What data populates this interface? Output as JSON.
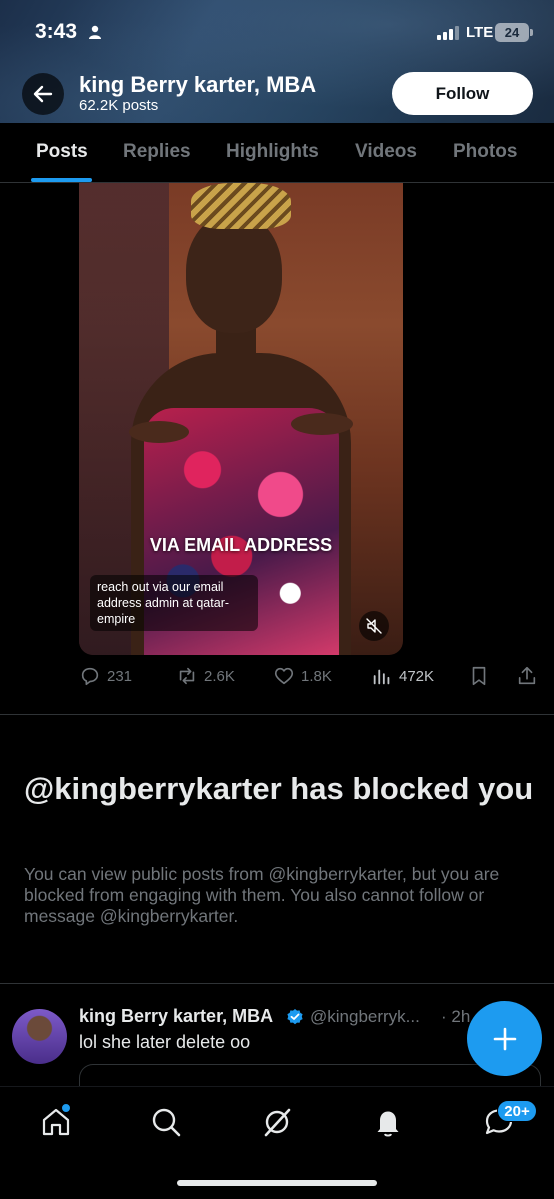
{
  "status_bar": {
    "time": "3:43",
    "network": "LTE",
    "battery": "24"
  },
  "header": {
    "profile_name": "king Berry karter, MBA",
    "post_count": "62.2K posts",
    "follow_label": "Follow"
  },
  "tabs": [
    {
      "label": "Posts",
      "active": true
    },
    {
      "label": "Replies"
    },
    {
      "label": "Highlights"
    },
    {
      "label": "Videos"
    },
    {
      "label": "Photos"
    }
  ],
  "media": {
    "overlay_text": "VIA EMAIL ADDRESS",
    "caption": "reach out via our email address admin at qatar-empire"
  },
  "actions": {
    "replies": "231",
    "reposts": "2.6K",
    "likes": "1.8K",
    "views": "472K"
  },
  "blocked": {
    "title": "@kingberrykarter has blocked you",
    "description": "You can view public posts from @kingberrykarter, but you are blocked from engaging with them. You also cannot follow or message @kingberrykarter."
  },
  "reply_post": {
    "name": "king Berry karter, MBA",
    "handle": "@kingberryk...",
    "time": "· 2h",
    "text": "lol she later delete oo"
  },
  "bottom_nav": {
    "messages_badge": "20+"
  },
  "colors": {
    "accent": "#1d9bf0",
    "muted": "#71767b",
    "text": "#e7e9ea",
    "background": "#000000"
  }
}
